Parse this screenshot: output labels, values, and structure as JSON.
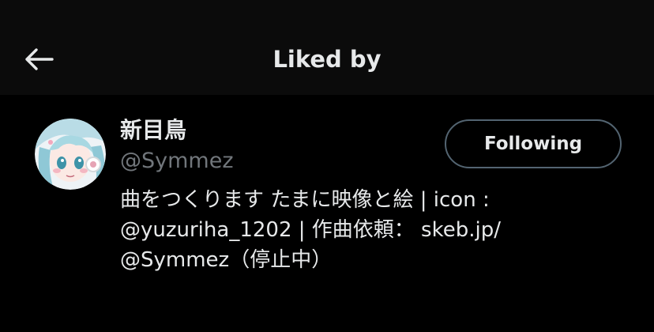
{
  "header": {
    "title": "Liked by",
    "back_icon": "arrow-left-icon"
  },
  "user": {
    "display_name": "新目鳥",
    "handle": "@Symmez",
    "follow_button_label": "Following",
    "bio_lines": [
      "曲をつくります たまに映像と絵 | icon :",
      "@yuzuriha_1202 | 作曲依頼： skeb.jp/",
      "@Symmez（停止中）"
    ]
  },
  "colors": {
    "background": "#000000",
    "header_background": "#0b0b0b",
    "text_primary": "#e7e9ea",
    "text_secondary": "#71767b",
    "button_border": "#536471"
  }
}
